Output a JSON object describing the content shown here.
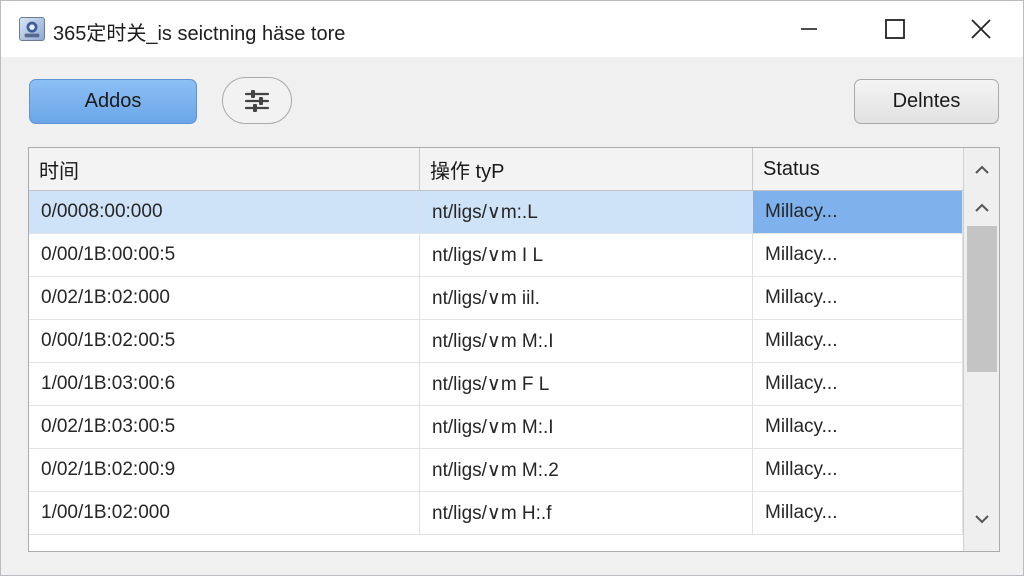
{
  "window": {
    "title": "365定时关_is seictning häse tore"
  },
  "toolbar": {
    "add_label": "Addos",
    "filter_icon": "sliders-icon",
    "delete_label": "Delntes"
  },
  "table": {
    "columns": [
      "时间",
      "操作 tyP",
      "Status"
    ],
    "rows": [
      {
        "time": "0/0008:00:000",
        "op": "nt/ligs/∨m:.L",
        "status": "Millacy...",
        "selected": true
      },
      {
        "time": "0/00/1B:00:00:5",
        "op": "nt/ligs/∨m I L",
        "status": "Millacy..."
      },
      {
        "time": "0/02/1B:02:000",
        "op": "nt/ligs/∨m iil.",
        "status": "Millacy..."
      },
      {
        "time": "0/00/1B:02:00:5",
        "op": "nt/ligs/∨m M:.I",
        "status": "Millacy..."
      },
      {
        "time": "1/00/1B:03:00:6",
        "op": "nt/ligs/∨m F L",
        "status": "Millacy..."
      },
      {
        "time": "0/02/1B:03:00:5",
        "op": "nt/ligs/∨m M:.I",
        "status": "Millacy..."
      },
      {
        "time": "0/02/1B:02:00:9",
        "op": "nt/ligs/∨m M:.2",
        "status": "Millacy..."
      },
      {
        "time": "1/00/1B:02:000",
        "op": "nt/ligs/∨m H:.f",
        "status": "Millacy..."
      }
    ]
  },
  "colors": {
    "accent": "#6aa6e8",
    "selected_row": "#cfe3f8",
    "selected_cell": "#7fb2ec"
  }
}
